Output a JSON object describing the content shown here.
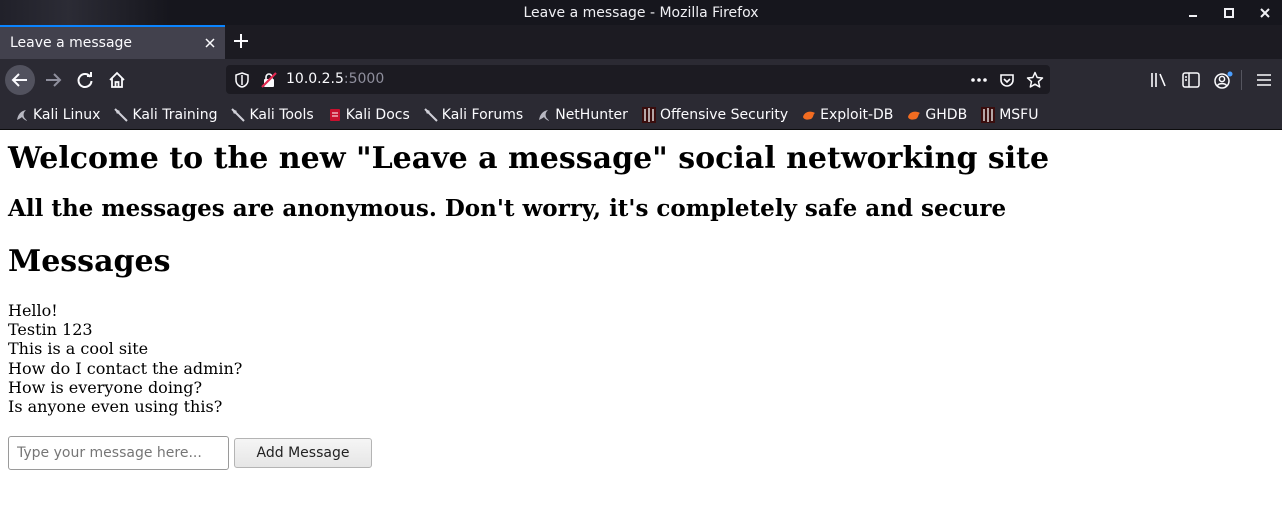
{
  "window": {
    "title": "Leave a message - Mozilla Firefox"
  },
  "tabs": [
    {
      "label": "Leave a message"
    }
  ],
  "url": {
    "host": "10.0.2.5",
    "port": ":5000"
  },
  "bookmarks": [
    {
      "label": "Kali Linux",
      "icon": "kali-dragon-icon"
    },
    {
      "label": "Kali Training",
      "icon": "kali-sword-icon"
    },
    {
      "label": "Kali Tools",
      "icon": "kali-sword-icon"
    },
    {
      "label": "Kali Docs",
      "icon": "kali-docs-icon"
    },
    {
      "label": "Kali Forums",
      "icon": "kali-sword-icon"
    },
    {
      "label": "NetHunter",
      "icon": "kali-dragon-icon"
    },
    {
      "label": "Offensive Security",
      "icon": "offsec-icon"
    },
    {
      "label": "Exploit-DB",
      "icon": "exploit-db-icon"
    },
    {
      "label": "GHDB",
      "icon": "exploit-db-icon"
    },
    {
      "label": "MSFU",
      "icon": "offsec-icon"
    }
  ],
  "page": {
    "heading": "Welcome to the new \"Leave a message\" social networking site",
    "subheading": "All the messages are anonymous. Don't worry, it's completely safe and secure",
    "messages_heading": "Messages",
    "messages": [
      "Hello!",
      "Testin 123",
      "This is a cool site",
      "How do I contact the admin?",
      "How is everyone doing?",
      "Is anyone even using this?"
    ],
    "input_placeholder": "Type your message here...",
    "input_value": "",
    "add_button_label": "Add Message"
  },
  "colors": {
    "titlebar_bg": "#16161d",
    "toolbar_bg": "#2b2a33",
    "tab_active_bg": "#42414d",
    "tab_accent": "#0a84ff",
    "urlbar_bg": "#1c1b22"
  }
}
